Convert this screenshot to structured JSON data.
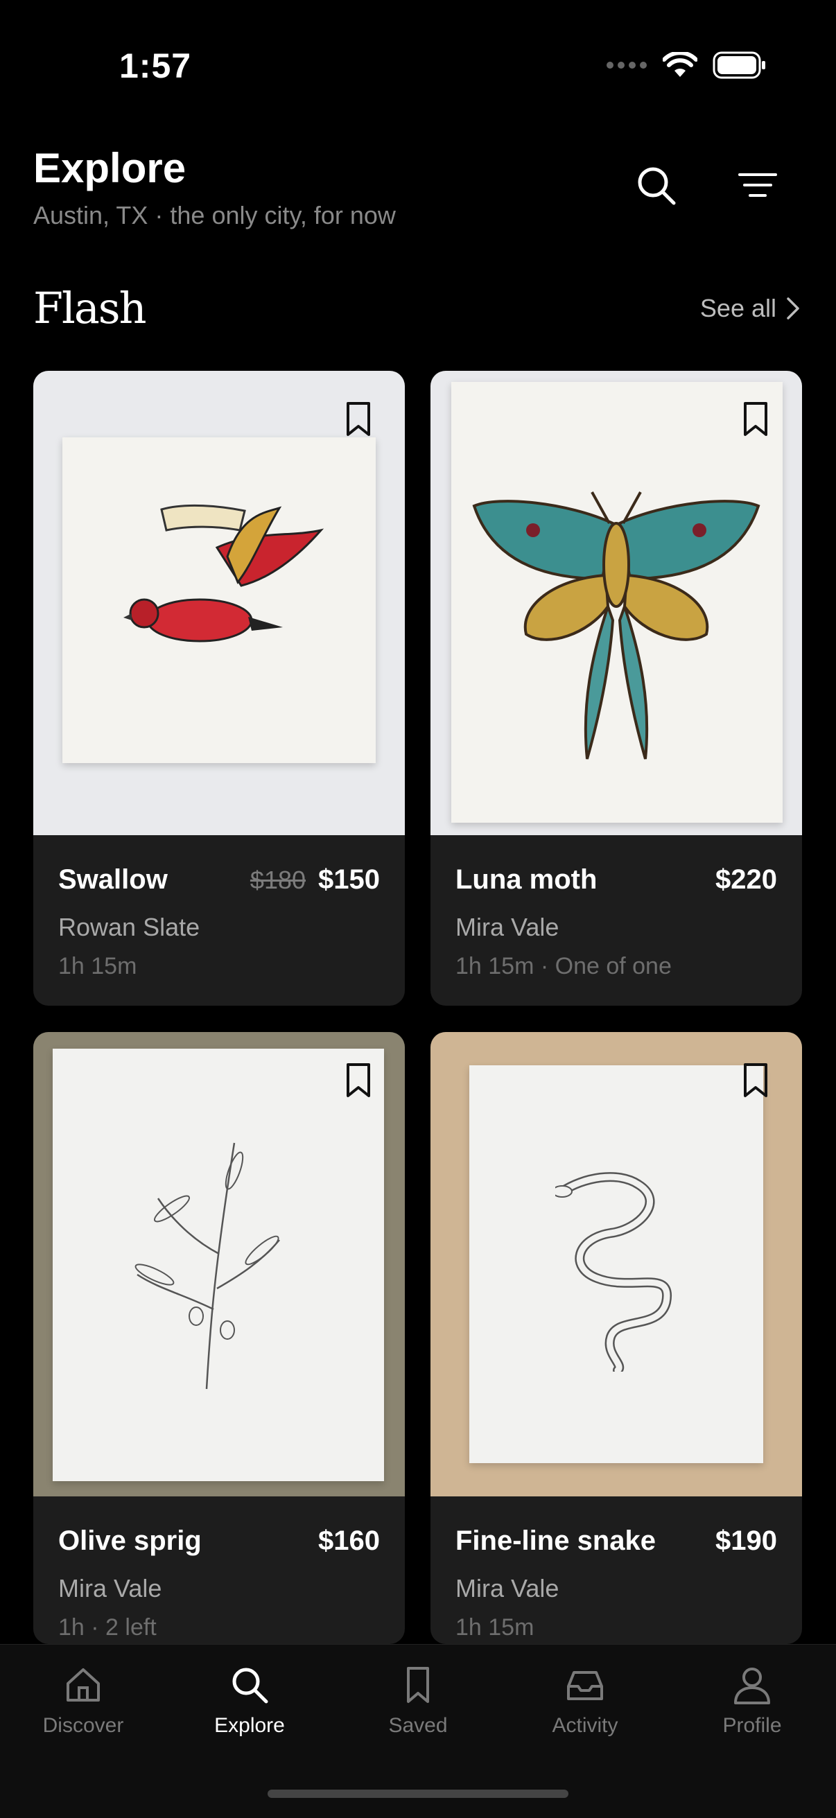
{
  "status": {
    "time": "1:57"
  },
  "header": {
    "title": "Explore",
    "subtitle": "Austin, TX · the only city, for now",
    "search_icon": "search-icon",
    "filter_icon": "filter-icon"
  },
  "section": {
    "title": "Flash",
    "see_all": "See all"
  },
  "cards": [
    {
      "name": "Swallow",
      "old_price": "$180",
      "price": "$150",
      "artist": "Rowan Slate",
      "meta": "1h 15m"
    },
    {
      "name": "Luna moth",
      "price": "$220",
      "artist": "Mira Vale",
      "meta": "1h 15m · One of one"
    },
    {
      "name": "Olive sprig",
      "price": "$160",
      "artist": "Mira Vale",
      "meta": "1h · 2 left"
    },
    {
      "name": "Fine-line snake",
      "price": "$190",
      "artist": "Mira Vale",
      "meta": "1h 15m"
    }
  ],
  "tabs": [
    {
      "label": "Discover",
      "icon": "home-icon"
    },
    {
      "label": "Explore",
      "icon": "search-icon",
      "active": true
    },
    {
      "label": "Saved",
      "icon": "bookmark-icon"
    },
    {
      "label": "Activity",
      "icon": "inbox-icon"
    },
    {
      "label": "Profile",
      "icon": "person-icon"
    }
  ],
  "colors": {
    "background": "#000000",
    "card": "#1d1d1d",
    "muted": "#8a8a8a"
  }
}
